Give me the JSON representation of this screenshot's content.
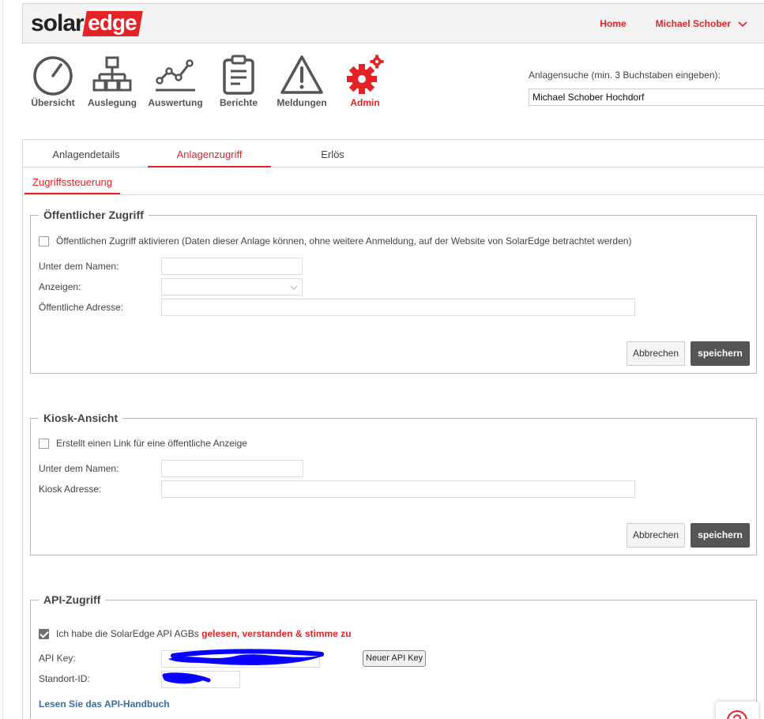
{
  "header": {
    "logo_solar": "solar",
    "logo_edge": "edge",
    "nav": {
      "home": "Home",
      "user": "Michael Schober"
    }
  },
  "toolbar": {
    "items": [
      {
        "label": "Übersicht",
        "icon": "gauge-icon"
      },
      {
        "label": "Auslegung",
        "icon": "hierarchy-icon"
      },
      {
        "label": "Auswertung",
        "icon": "line-chart-icon"
      },
      {
        "label": "Berichte",
        "icon": "clipboard-icon"
      },
      {
        "label": "Meldungen",
        "icon": "warning-icon"
      },
      {
        "label": "Admin",
        "icon": "gears-icon",
        "active": true
      }
    ]
  },
  "search": {
    "label": "Anlagensuche (min. 3 Buchstaben eingeben):",
    "value": "Michael Schober Hochdorf"
  },
  "tabs": [
    {
      "label": "Anlagendetails"
    },
    {
      "label": "Anlagenzugriff",
      "active": true
    },
    {
      "label": "Erlös"
    }
  ],
  "subtabs": [
    {
      "label": "Zugriffssteuerung",
      "active": true
    }
  ],
  "public_access": {
    "legend": "Öffentlicher Zugriff",
    "checkbox_label": "Öffentlichen Zugriff aktivieren (Daten dieser Anlage können, ohne weitere Anmeldung, auf der Website von SolarEdge betrachtet werden)",
    "name_label": "Unter dem Namen:",
    "name_value": "",
    "show_label": "Anzeigen:",
    "show_value": "",
    "address_label": "Öffentliche Adresse:",
    "address_value": "",
    "cancel": "Abbrechen",
    "save": "speichern"
  },
  "kiosk": {
    "legend": "Kiosk-Ansicht",
    "checkbox_label": "Erstellt einen Link für eine öffentliche Anzeige",
    "name_label": "Unter dem Namen:",
    "name_value": "",
    "address_label": "Kiosk Adresse:",
    "address_value": "",
    "cancel": "Abbrechen",
    "save": "speichern"
  },
  "api": {
    "legend": "API-Zugriff",
    "terms_prefix": "Ich habe die SolarEdge API AGBs ",
    "terms_link": "gelesen, verstanden & stimme zu",
    "terms_checked": true,
    "key_label": "API Key:",
    "new_key_button": "Neuer API Key",
    "site_label": "Standort-ID:",
    "manual_link": "Lesen Sie das API-Handbuch"
  },
  "colors": {
    "brand_red": "#e52327",
    "save_button": "#555555",
    "link_blue": "#3a6ea5",
    "redaction": "#0a00ff"
  }
}
